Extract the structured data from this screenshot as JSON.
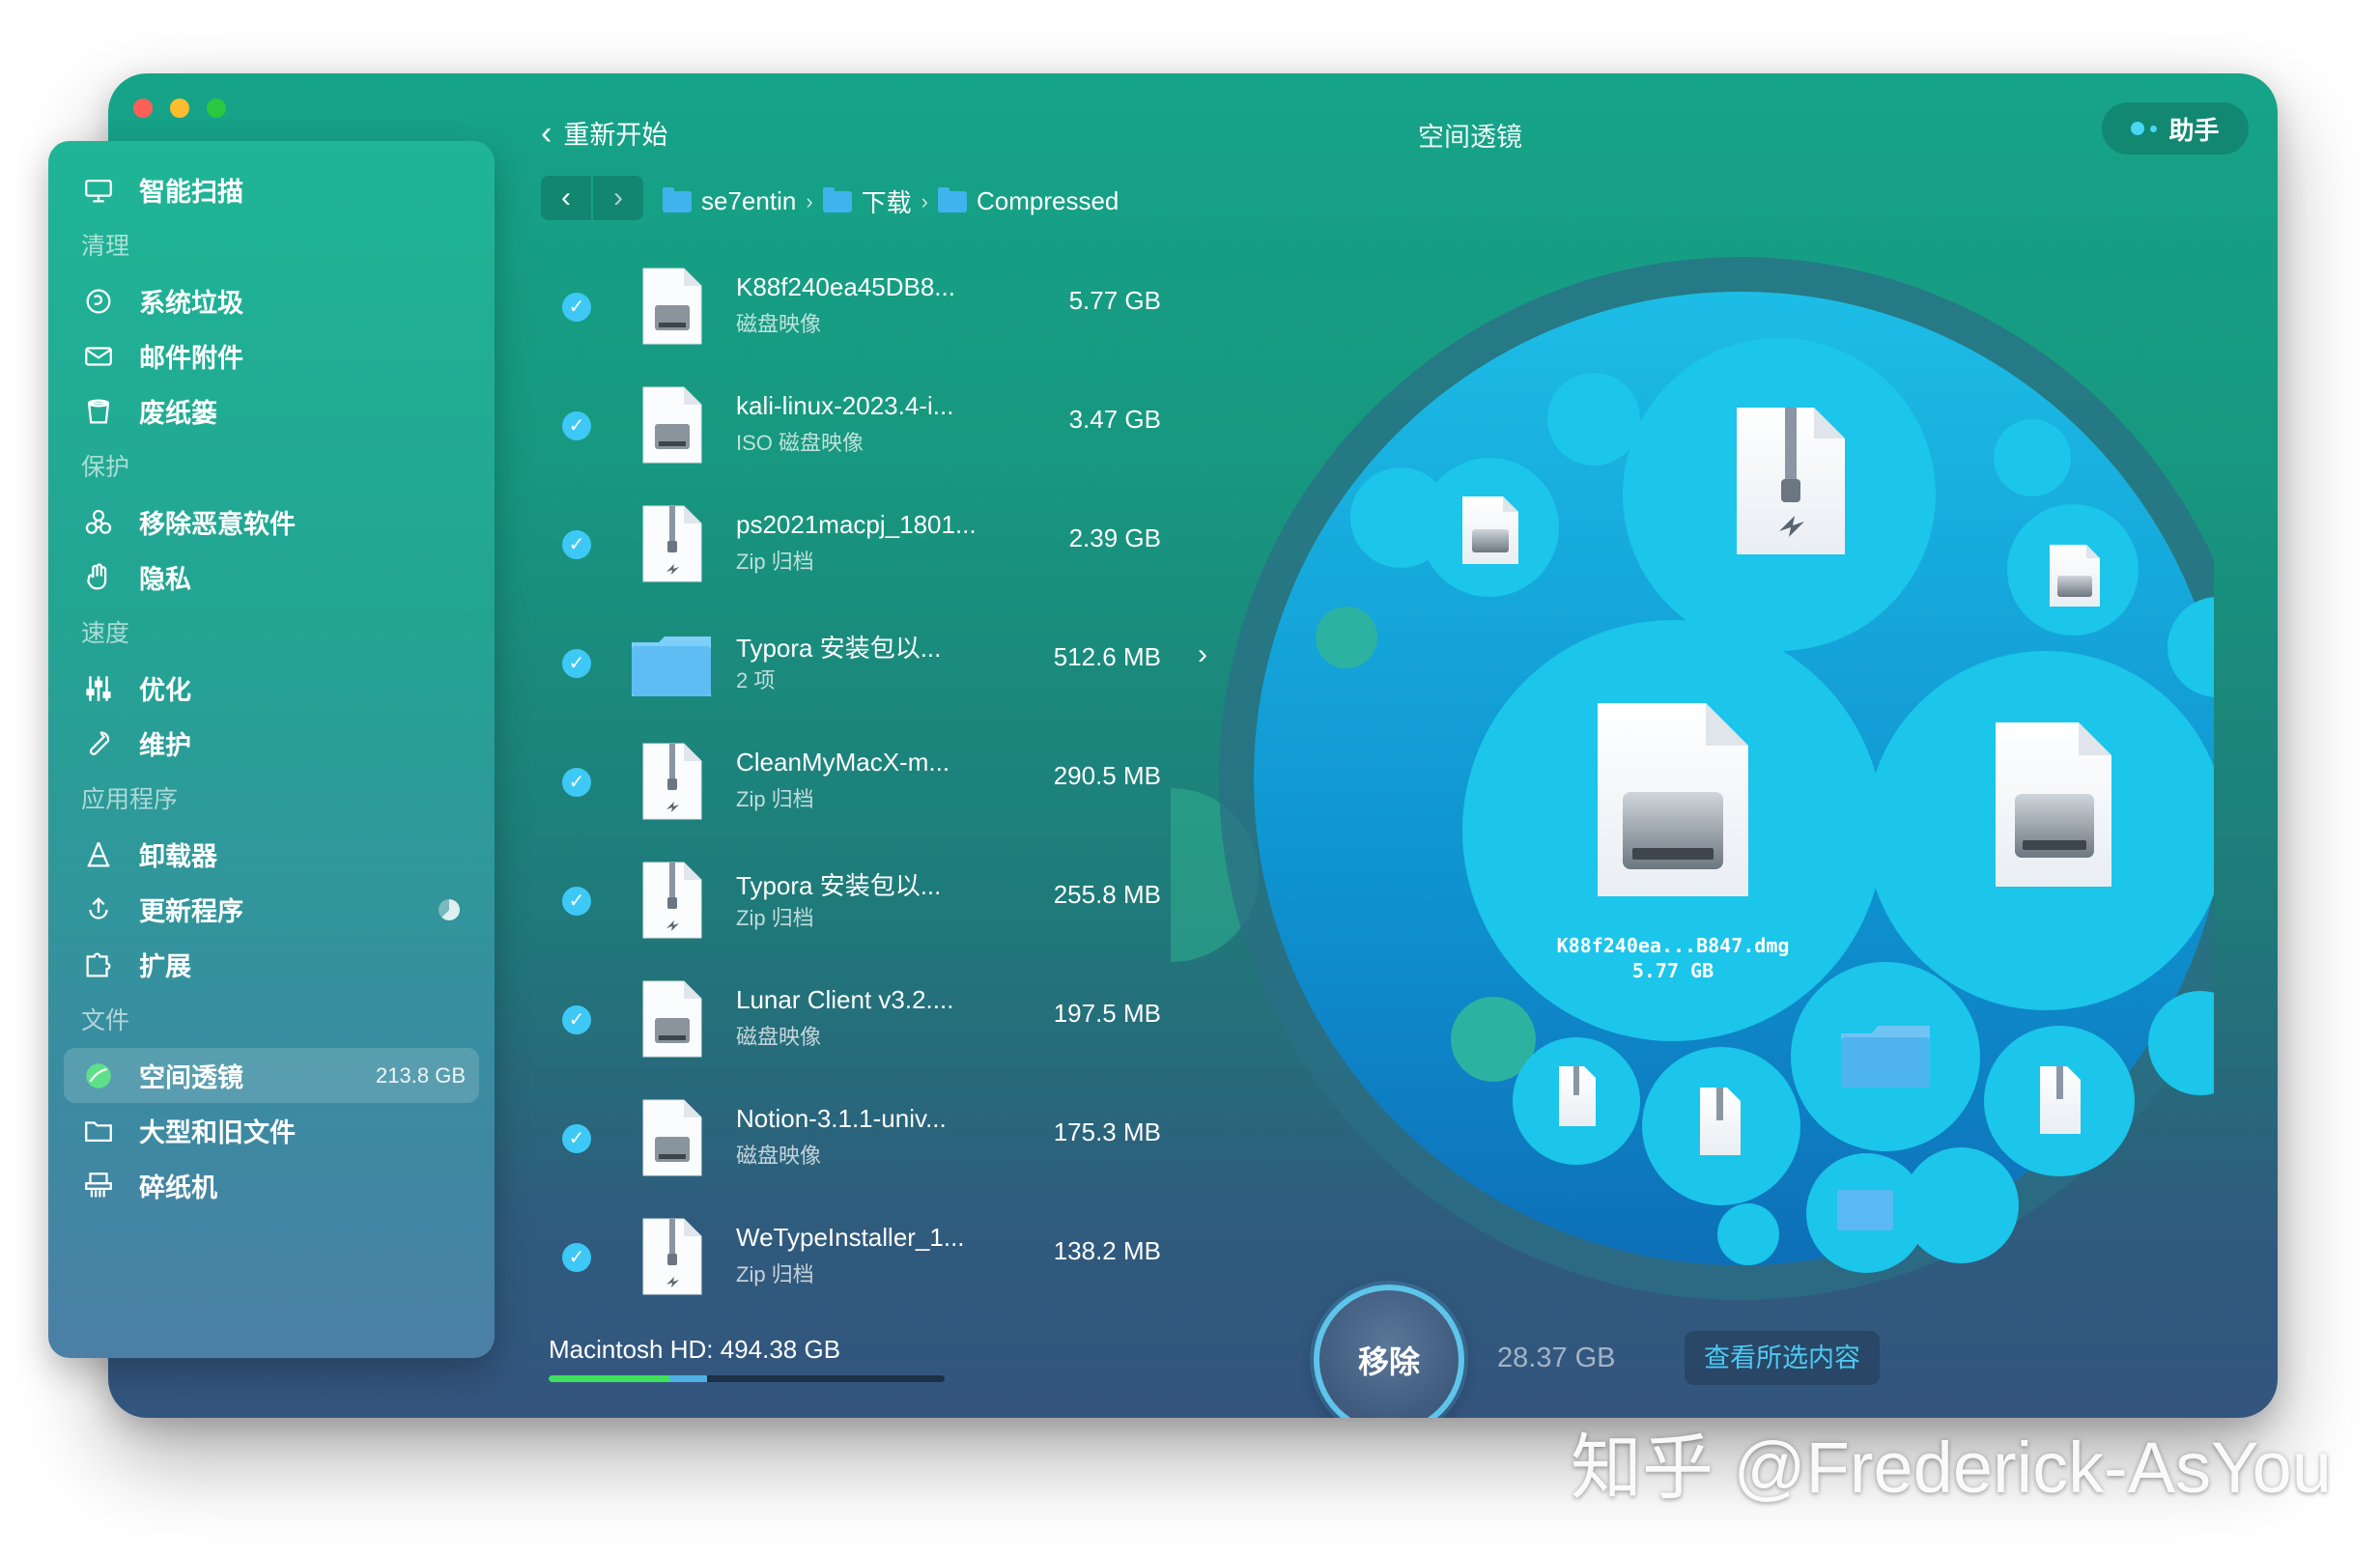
{
  "window": {
    "title": "空间透镜",
    "back_label": "重新开始",
    "assistant_label": "助手"
  },
  "sidebar": {
    "top_item": {
      "label": "智能扫描",
      "icon": "monitor-icon"
    },
    "sections": [
      {
        "title": "清理",
        "items": [
          {
            "label": "系统垃圾",
            "icon": "trash-icon"
          },
          {
            "label": "邮件附件",
            "icon": "mail-icon"
          },
          {
            "label": "废纸篓",
            "icon": "bin-icon"
          }
        ]
      },
      {
        "title": "保护",
        "items": [
          {
            "label": "移除恶意软件",
            "icon": "biohazard-icon"
          },
          {
            "label": "隐私",
            "icon": "hand-icon"
          }
        ]
      },
      {
        "title": "速度",
        "items": [
          {
            "label": "优化",
            "icon": "sliders-icon"
          },
          {
            "label": "维护",
            "icon": "wrench-icon"
          }
        ]
      },
      {
        "title": "应用程序",
        "items": [
          {
            "label": "卸载器",
            "icon": "uninstall-icon"
          },
          {
            "label": "更新程序",
            "icon": "update-icon"
          },
          {
            "label": "扩展",
            "icon": "puzzle-icon"
          }
        ]
      },
      {
        "title": "文件",
        "items": [
          {
            "label": "空间透镜",
            "icon": "lens-icon",
            "badge": "213.8 GB",
            "active": true
          },
          {
            "label": "大型和旧文件",
            "icon": "folder-icon"
          },
          {
            "label": "碎纸机",
            "icon": "shredder-icon"
          }
        ]
      }
    ]
  },
  "breadcrumb": [
    "se7entin",
    "下载",
    "Compressed"
  ],
  "files": [
    {
      "name": "K88f240ea45DB8...",
      "kind": "磁盘映像",
      "size": "5.77 GB",
      "icon": "disk-image-icon"
    },
    {
      "name": "kali-linux-2023.4-i...",
      "kind": "ISO 磁盘映像",
      "size": "3.47 GB",
      "icon": "disk-image-icon"
    },
    {
      "name": "ps2021macpj_1801...",
      "kind": "Zip 归档",
      "size": "2.39 GB",
      "icon": "zip-icon"
    },
    {
      "name": "Typora 安装包以...",
      "kind": "2 项",
      "size": "512.6 MB",
      "icon": "folder-icon",
      "has_children": true
    },
    {
      "name": "CleanMyMacX-m...",
      "kind": "Zip 归档",
      "size": "290.5 MB",
      "icon": "zip-icon"
    },
    {
      "name": "Typora 安装包以...",
      "kind": "Zip 归档",
      "size": "255.8 MB",
      "icon": "zip-icon"
    },
    {
      "name": "Lunar Client v3.2....",
      "kind": "磁盘映像",
      "size": "197.5 MB",
      "icon": "disk-image-icon"
    },
    {
      "name": "Notion-3.1.1-univ...",
      "kind": "磁盘映像",
      "size": "175.3 MB",
      "icon": "disk-image-icon"
    },
    {
      "name": "WeTypeInstaller_1...",
      "kind": "Zip 归档",
      "size": "138.2 MB",
      "icon": "zip-icon"
    }
  ],
  "disk": {
    "label": "Macintosh HD: 494.38 GB",
    "used_fraction": 0.4,
    "selected_fraction": 0.095
  },
  "bubble": {
    "name": "K88f240ea...B847.dmg",
    "size": "5.77 GB"
  },
  "actions": {
    "remove_label": "移除",
    "selected_size": "28.37 GB",
    "view_selected_label": "查看所选内容"
  },
  "watermark": "知乎 @Frederick-AsYou",
  "colors": {
    "accent_blue": "#3ec8f5",
    "bubble_blue": "#0bbbe4",
    "window_green": "#16a489",
    "window_navy": "#34557e"
  }
}
